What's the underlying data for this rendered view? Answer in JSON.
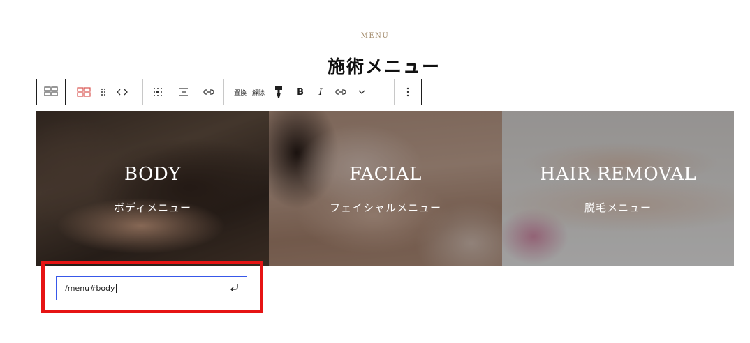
{
  "section": {
    "eyebrow": "MENU",
    "title": "施術メニュー"
  },
  "toolbar": {
    "replace_label": "置換",
    "unlink_label": "解除",
    "bold_label": "B",
    "italic_label": "I"
  },
  "cards": [
    {
      "heading": "BODY",
      "subheading": "ボディメニュー"
    },
    {
      "heading": "FACIAL",
      "subheading": "フェイシャルメニュー"
    },
    {
      "heading": "HAIR REMOVAL",
      "subheading": "脱毛メニュー"
    }
  ],
  "link_input": {
    "value": "/menu#body"
  },
  "colors": {
    "highlight": "#e61414",
    "focus_border": "#3858e9",
    "eyebrow": "#a08868"
  }
}
